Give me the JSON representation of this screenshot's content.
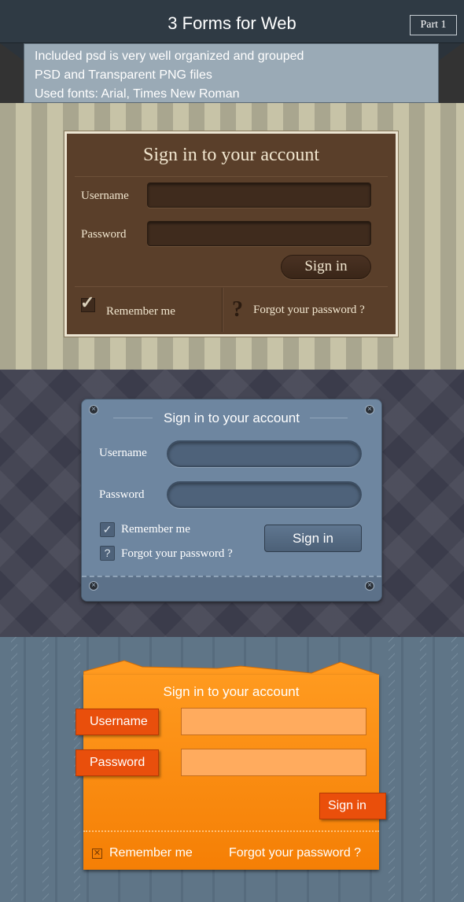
{
  "header": {
    "title": "3 Forms for Web",
    "part": "Part 1",
    "info_lines": [
      "Included psd is very well organized and grouped",
      "PSD and Transparent PNG files",
      "Used fonts: Arial, Times New Roman"
    ]
  },
  "form_brown": {
    "title": "Sign in to your account",
    "username_label": "Username",
    "password_label": "Password",
    "signin_label": "Sign in",
    "remember_label": "Remember me",
    "forgot_label": "Forgot your password ?",
    "question_glyph": "?",
    "remember_checked": true
  },
  "form_blue": {
    "title": "Sign in to your account",
    "username_label": "Username",
    "password_label": "Password",
    "remember_label": "Remember me",
    "forgot_label": "Forgot your password ?",
    "question_glyph": "?",
    "signin_label": "Sign in",
    "remember_checked": true
  },
  "form_orange": {
    "title": "Sign in to your account",
    "username_label": "Username",
    "password_label": "Password",
    "signin_label": "Sign in",
    "remember_label": "Remember me",
    "forgot_label": "Forgot your password ?",
    "remember_checked": true
  },
  "colors": {
    "header_bg": "#2f3a44",
    "info_bg": "#9aaab6",
    "brown_form": "#5a3f2a",
    "blue_form": "#6e86a0",
    "orange_form": "#f78e10",
    "orange_accent": "#e94f0c"
  }
}
